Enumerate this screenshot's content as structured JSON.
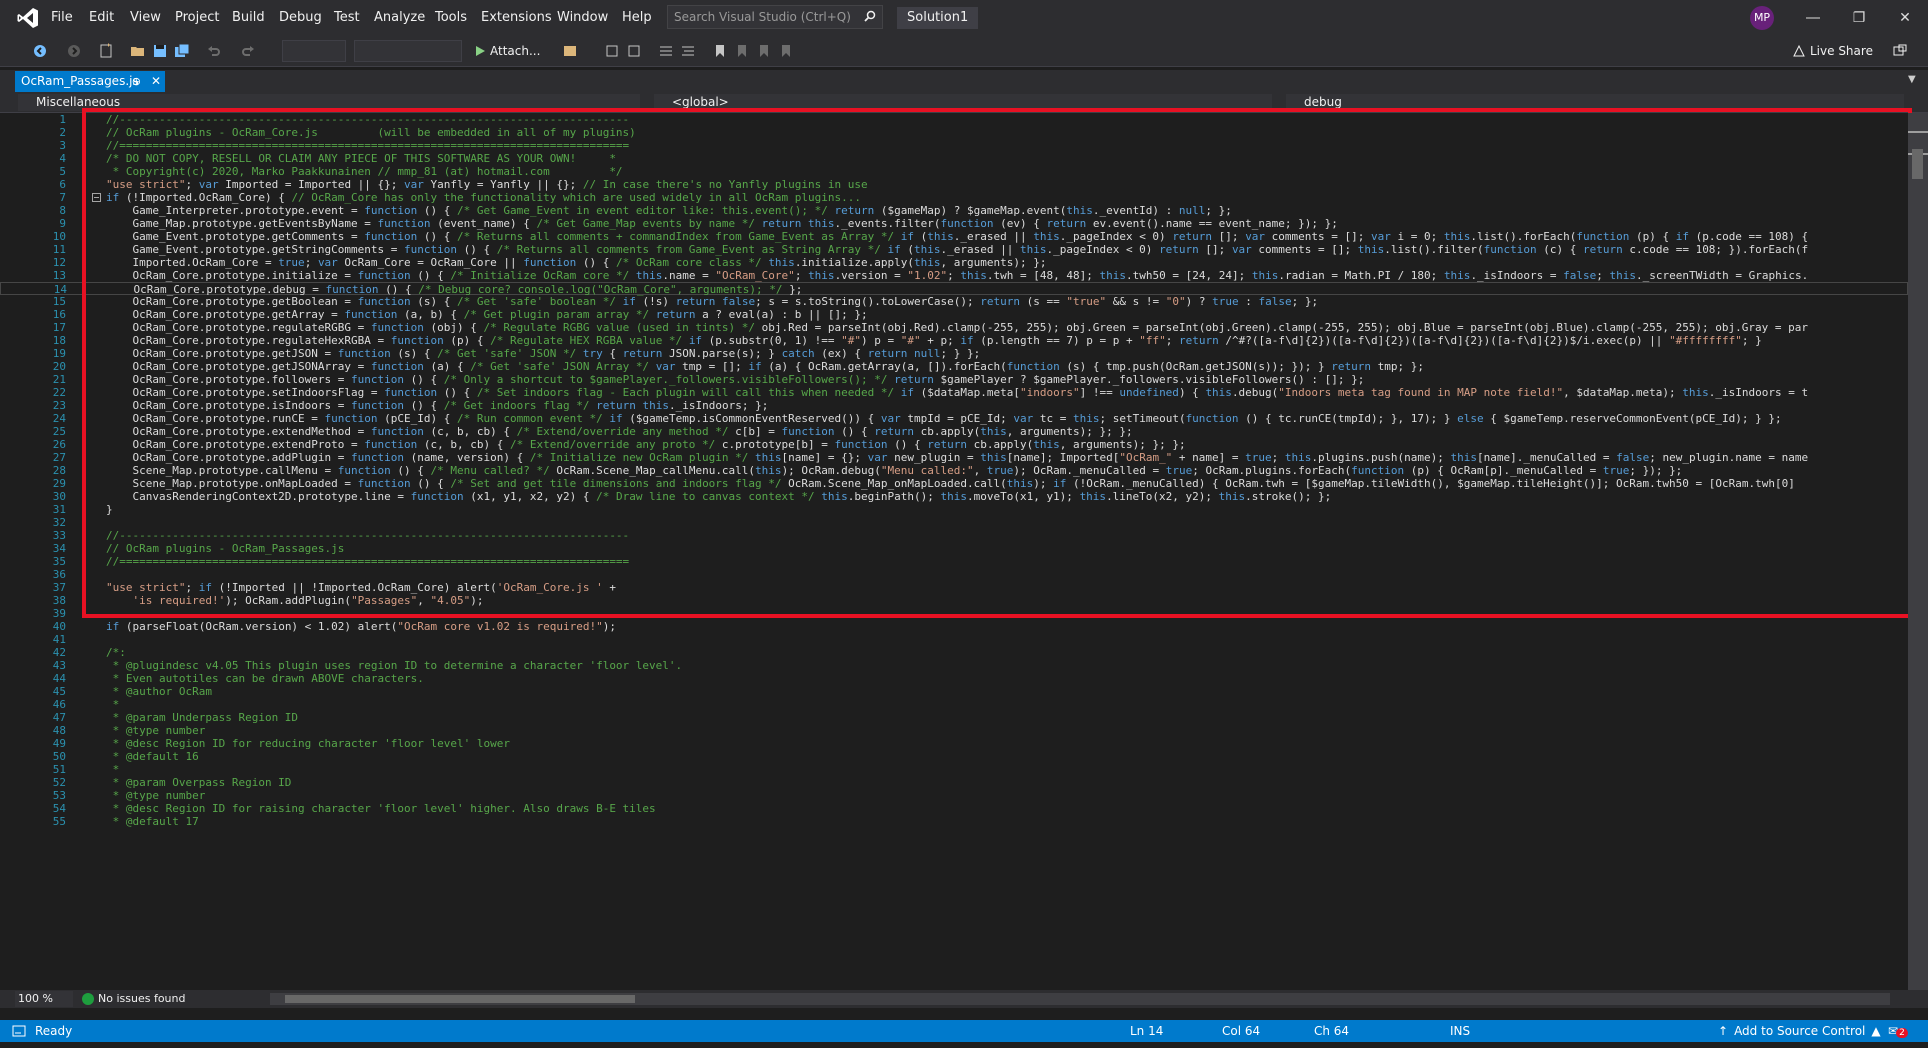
{
  "menubar": {
    "items": [
      "File",
      "Edit",
      "View",
      "Project",
      "Build",
      "Debug",
      "Test",
      "Analyze",
      "Tools",
      "Extensions",
      "Window",
      "Help"
    ],
    "search_placeholder": "Search Visual Studio (Ctrl+Q)",
    "solution": "Solution1",
    "avatar": "MP"
  },
  "toolbar": {
    "attach": "Attach...",
    "live_share": "Live Share"
  },
  "tab": {
    "label": "OcRam_Passages.js",
    "pin": "⊕",
    "close": "✕"
  },
  "navbar": {
    "project": "Miscellaneous",
    "scope": "<global>",
    "member": "debug"
  },
  "editor": {
    "lines": [
      {
        "n": "1",
        "t": "//-----------------------------------------------------------------------------"
      },
      {
        "n": "2",
        "t": "// OcRam plugins - OcRam_Core.js         (will be embedded in all of my plugins)"
      },
      {
        "n": "3",
        "t": "//============================================================================="
      },
      {
        "n": "4",
        "t": "/* DO NOT COPY, RESELL OR CLAIM ANY PIECE OF THIS SOFTWARE AS YOUR OWN!     *"
      },
      {
        "n": "5",
        "t": " * Copyright(c) 2020, Marko Paakkunainen // mmp_81 (at) hotmail.com         */"
      },
      {
        "n": "6",
        "t": "\"use strict\"; var Imported = Imported || {}; var Yanfly = Yanfly || {}; // In case there's no Yanfly plugins in use"
      },
      {
        "n": "7",
        "t": "if (!Imported.OcRam_Core) { // OcRam_Core has only the functionality which are used widely in all OcRam plugins..."
      },
      {
        "n": "8",
        "t": "    Game_Interpreter.prototype.event = function () { /* Get Game_Event in event editor like: this.event(); */ return ($gameMap) ? $gameMap.event(this._eventId) : null; };"
      },
      {
        "n": "9",
        "t": "    Game_Map.prototype.getEventsByName = function (event_name) { /* Get Game_Map events by name */ return this._events.filter(function (ev) { return ev.event().name == event_name; }); };"
      },
      {
        "n": "10",
        "t": "    Game_Event.prototype.getComments = function () { /* Returns all comments + commandIndex from Game_Event as Array */ if (this._erased || this._pageIndex < 0) return []; var comments = []; var i = 0; this.list().forEach(function (p) { if (p.code == 108) {"
      },
      {
        "n": "11",
        "t": "    Game_Event.prototype.getStringComments = function () { /* Returns all comments from Game_Event as String Array */ if (this._erased || this._pageIndex < 0) return []; var comments = []; this.list().filter(function (c) { return c.code == 108; }).forEach(f"
      },
      {
        "n": "12",
        "t": "    Imported.OcRam_Core = true; var OcRam_Core = OcRam_Core || function () { /* OcRam core class */ this.initialize.apply(this, arguments); };"
      },
      {
        "n": "13",
        "t": "    OcRam_Core.prototype.initialize = function () { /* Initialize OcRam core */ this.name = \"OcRam_Core\"; this.version = \"1.02\"; this.twh = [48, 48]; this.twh50 = [24, 24]; this.radian = Math.PI / 180; this._isIndoors = false; this._screenTWidth = Graphics."
      },
      {
        "n": "14",
        "t": "    OcRam_Core.prototype.debug = function () { /* Debug core? console.log(\"OcRam_Core\", arguments); */ };"
      },
      {
        "n": "15",
        "t": "    OcRam_Core.prototype.getBoolean = function (s) { /* Get 'safe' boolean */ if (!s) return false; s = s.toString().toLowerCase(); return (s == \"true\" && s != \"0\") ? true : false; };"
      },
      {
        "n": "16",
        "t": "    OcRam_Core.prototype.getArray = function (a, b) { /* Get plugin param array */ return a ? eval(a) : b || []; };"
      },
      {
        "n": "17",
        "t": "    OcRam_Core.prototype.regulateRGBG = function (obj) { /* Regulate RGBG value (used in tints) */ obj.Red = parseInt(obj.Red).clamp(-255, 255); obj.Green = parseInt(obj.Green).clamp(-255, 255); obj.Blue = parseInt(obj.Blue).clamp(-255, 255); obj.Gray = par"
      },
      {
        "n": "18",
        "t": "    OcRam_Core.prototype.regulateHexRGBA = function (p) { /* Regulate HEX RGBA value */ if (p.substr(0, 1) !== \"#\") p = \"#\" + p; if (p.length == 7) p = p + \"ff\"; return /^#?([a-f\\d]{2})([a-f\\d]{2})([a-f\\d]{2})([a-f\\d]{2})$/i.exec(p) || \"#ffffffff\"; }"
      },
      {
        "n": "19",
        "t": "    OcRam_Core.prototype.getJSON = function (s) { /* Get 'safe' JSON */ try { return JSON.parse(s); } catch (ex) { return null; } };"
      },
      {
        "n": "20",
        "t": "    OcRam_Core.prototype.getJSONArray = function (a) { /* Get 'safe' JSON Array */ var tmp = []; if (a) { OcRam.getArray(a, []).forEach(function (s) { tmp.push(OcRam.getJSON(s)); }); } return tmp; };"
      },
      {
        "n": "21",
        "t": "    OcRam_Core.prototype.followers = function () { /* Only a shortcut to $gamePlayer._followers.visibleFollowers(); */ return $gamePlayer ? $gamePlayer._followers.visibleFollowers() : []; };"
      },
      {
        "n": "22",
        "t": "    OcRam_Core.prototype.setIndoorsFlag = function () { /* Set indoors flag - Each plugin will call this when needed */ if ($dataMap.meta[\"indoors\"] !== undefined) { this.debug(\"Indoors meta tag found in MAP note field!\", $dataMap.meta); this._isIndoors = t"
      },
      {
        "n": "23",
        "t": "    OcRam_Core.prototype.isIndoors = function () { /* Get indoors flag */ return this._isIndoors; };"
      },
      {
        "n": "24",
        "t": "    OcRam_Core.prototype.runCE = function (pCE_Id) { /* Run common event */ if ($gameTemp.isCommonEventReserved()) { var tmpId = pCE_Id; var tc = this; setTimeout(function () { tc.runCE(tmpId); }, 17); } else { $gameTemp.reserveCommonEvent(pCE_Id); } };"
      },
      {
        "n": "25",
        "t": "    OcRam_Core.prototype.extendMethod = function (c, b, cb) { /* Extend/override any method */ c[b] = function () { return cb.apply(this, arguments); }; };"
      },
      {
        "n": "26",
        "t": "    OcRam_Core.prototype.extendProto = function (c, b, cb) { /* Extend/override any proto */ c.prototype[b] = function () { return cb.apply(this, arguments); }; };"
      },
      {
        "n": "27",
        "t": "    OcRam_Core.prototype.addPlugin = function (name, version) { /* Initialize new OcRam plugin */ this[name] = {}; var new_plugin = this[name]; Imported[\"OcRam_\" + name] = true; this.plugins.push(name); this[name]._menuCalled = false; new_plugin.name = name"
      },
      {
        "n": "28",
        "t": "    Scene_Map.prototype.callMenu = function () { /* Menu called? */ OcRam.Scene_Map_callMenu.call(this); OcRam.debug(\"Menu called:\", true); OcRam._menuCalled = true; OcRam.plugins.forEach(function (p) { OcRam[p]._menuCalled = true; }); };"
      },
      {
        "n": "29",
        "t": "    Scene_Map.prototype.onMapLoaded = function () { /* Set and get tile dimensions and indoors flag */ OcRam.Scene_Map_onMapLoaded.call(this); if (!OcRam._menuCalled) { OcRam.twh = [$gameMap.tileWidth(), $gameMap.tileHeight()]; OcRam.twh50 = [OcRam.twh[0] "
      },
      {
        "n": "30",
        "t": "    CanvasRenderingContext2D.prototype.line = function (x1, y1, x2, y2) { /* Draw line to canvas context */ this.beginPath(); this.moveTo(x1, y1); this.lineTo(x2, y2); this.stroke(); };"
      },
      {
        "n": "31",
        "t": "}"
      },
      {
        "n": "32",
        "t": ""
      },
      {
        "n": "33",
        "t": "//-----------------------------------------------------------------------------"
      },
      {
        "n": "34",
        "t": "// OcRam plugins - OcRam_Passages.js"
      },
      {
        "n": "35",
        "t": "//============================================================================="
      },
      {
        "n": "36",
        "t": ""
      },
      {
        "n": "37",
        "t": "\"use strict\"; if (!Imported || !Imported.OcRam_Core) alert('OcRam_Core.js ' +"
      },
      {
        "n": "38",
        "t": "    'is required!'); OcRam.addPlugin(\"Passages\", \"4.05\");"
      },
      {
        "n": "39",
        "t": ""
      },
      {
        "n": "40",
        "t": "if (parseFloat(OcRam.version) < 1.02) alert(\"OcRam core v1.02 is required!\");"
      },
      {
        "n": "41",
        "t": ""
      },
      {
        "n": "42",
        "t": "/*:"
      },
      {
        "n": "43",
        "t": " * @plugindesc v4.05 This plugin uses region ID to determine a character 'floor level'."
      },
      {
        "n": "44",
        "t": " * Even autotiles can be drawn ABOVE characters."
      },
      {
        "n": "45",
        "t": " * @author OcRam"
      },
      {
        "n": "46",
        "t": " *"
      },
      {
        "n": "47",
        "t": " * @param Underpass Region ID"
      },
      {
        "n": "48",
        "t": " * @type number"
      },
      {
        "n": "49",
        "t": " * @desc Region ID for reducing character 'floor level' lower"
      },
      {
        "n": "50",
        "t": " * @default 16"
      },
      {
        "n": "51",
        "t": " *"
      },
      {
        "n": "52",
        "t": " * @param Overpass Region ID"
      },
      {
        "n": "53",
        "t": " * @type number"
      },
      {
        "n": "54",
        "t": " * @desc Region ID for raising character 'floor level' higher. Also draws B-E tiles"
      },
      {
        "n": "55",
        "t": " * @default 17"
      }
    ]
  },
  "footer": {
    "zoom": "100 %",
    "issues": "No issues found"
  },
  "status": {
    "ready": "Ready",
    "ln": "Ln 14",
    "col": "Col 64",
    "ch": "Ch 64",
    "ins": "INS",
    "source_control": "Add to Source Control",
    "notifications": "2"
  },
  "colors": {
    "accent": "#007acc",
    "highlight_box": "#e81123"
  }
}
